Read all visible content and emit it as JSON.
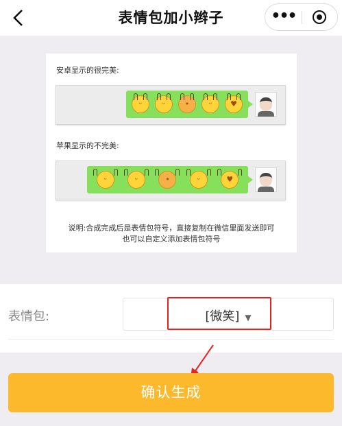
{
  "navbar": {
    "back_glyph": "‹",
    "title": "表情包加小辫子",
    "more_glyph": "•••"
  },
  "preview": {
    "android_label": "安卓显示的很完美:",
    "apple_label": "苹果显示的不完美:",
    "emoji_names": [
      "smile-face-icon",
      "grin-face-icon",
      "dog-face-icon",
      "smirk-face-icon",
      "kiss-face-icon"
    ],
    "note_line1": "说明:合成完成后是表情包符号，直接复制在微信里面发送即可",
    "note_line2": "也可以自定义添加表情包符号"
  },
  "form": {
    "label": "表情包:",
    "select_value": "[微笑]",
    "select_caret": "▼"
  },
  "confirm_button": "确认生成",
  "colors": {
    "accent": "#fbb92b",
    "bubble": "#86e05c",
    "highlight": "#e8231f"
  }
}
